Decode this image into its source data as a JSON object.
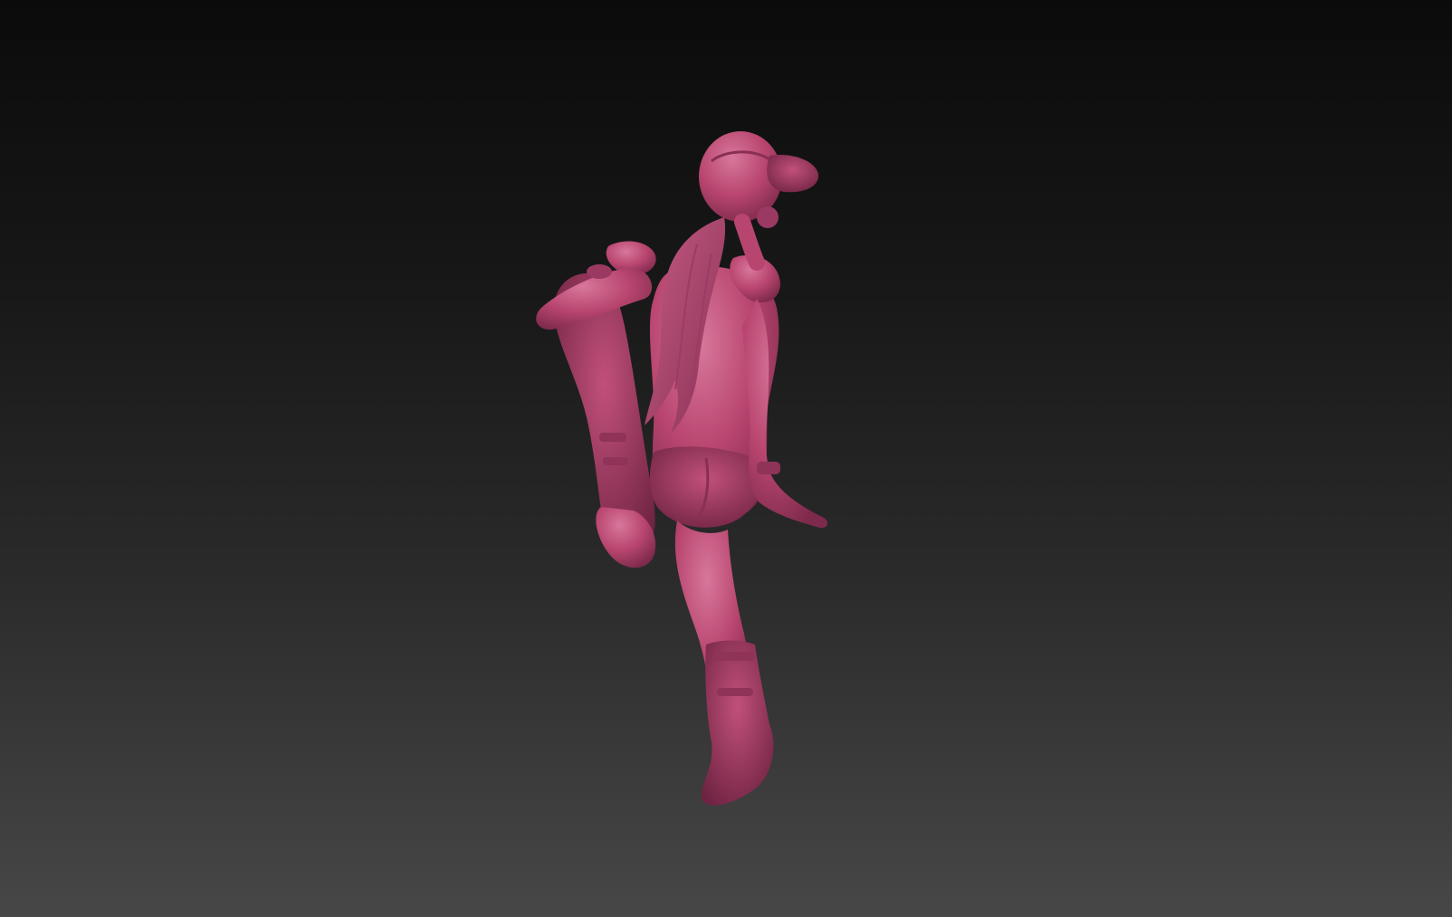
{
  "viewport": {
    "background_top_color": "#0b0b0b",
    "background_bottom_color": "#474747"
  },
  "model": {
    "material_color": "#b8456f",
    "shadow_color": "#7e2a4c",
    "highlight_color": "#d8779b",
    "icon": "sculpted-figure"
  }
}
